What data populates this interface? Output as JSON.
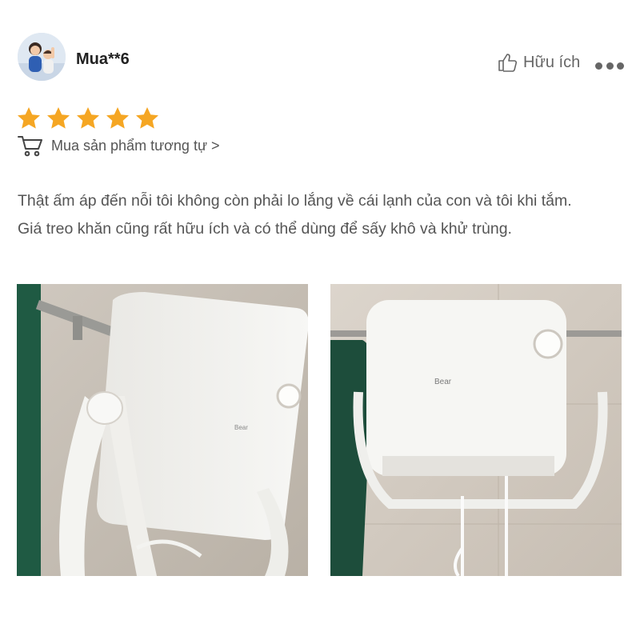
{
  "review": {
    "username": "Mua**6",
    "rating": 5,
    "helpful_label": "Hữu ích",
    "buy_similar_label": "Mua sản phẩm tương tự >",
    "text_line1": "Thật ấm áp đến nỗi tôi không còn phải lo lắng về cái lạnh của con và tôi khi tắm.",
    "text_line2": "Giá treo khăn cũng rất hữu ích và có thể dùng để sấy khô và khử trùng.",
    "brand_text": "Bear"
  },
  "colors": {
    "star": "#F5A623",
    "text": "#555555",
    "icon": "#666666"
  },
  "icons": [
    "avatar",
    "thumbs-up-icon",
    "more-icon",
    "star-icon",
    "cart-icon"
  ]
}
